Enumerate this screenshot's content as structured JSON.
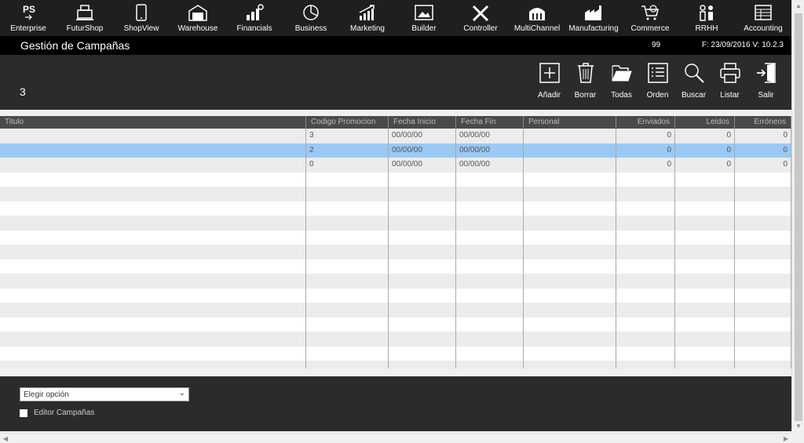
{
  "nav": [
    {
      "label": "Enterprise",
      "icon": "ps-enterprise-icon"
    },
    {
      "label": "FuturShop",
      "icon": "cash-register-icon"
    },
    {
      "label": "ShopView",
      "icon": "tablet-icon"
    },
    {
      "label": "Warehouse",
      "icon": "warehouse-icon"
    },
    {
      "label": "Financials",
      "icon": "bar-chart-icon"
    },
    {
      "label": "Business",
      "icon": "pie-chart-icon"
    },
    {
      "label": "Marketing",
      "icon": "growth-chart-icon"
    },
    {
      "label": "Builder",
      "icon": "image-frame-icon"
    },
    {
      "label": "Controller",
      "icon": "tools-icon"
    },
    {
      "label": "MultiChannel",
      "icon": "building-icon"
    },
    {
      "label": "Manufacturing",
      "icon": "factory-icon"
    },
    {
      "label": "Commerce",
      "icon": "cart-icon"
    },
    {
      "label": "RRHH",
      "icon": "people-icon"
    },
    {
      "label": "Accounting",
      "icon": "ledger-icon"
    }
  ],
  "enterprise_logo": "PS",
  "title": "Gestión de Campañas",
  "title_number": "99",
  "version": "F: 23/09/2016 V: 10.2.3",
  "record_count": "3",
  "tools": [
    {
      "label": "Añadir",
      "icon": "add-icon"
    },
    {
      "label": "Borrar",
      "icon": "trash-icon"
    },
    {
      "label": "Todas",
      "icon": "folder-open-icon"
    },
    {
      "label": "Orden",
      "icon": "list-icon"
    },
    {
      "label": "Buscar",
      "icon": "search-icon"
    },
    {
      "label": "Listar",
      "icon": "printer-icon"
    },
    {
      "label": "Salir",
      "icon": "exit-icon"
    }
  ],
  "grid": {
    "columns": [
      "Titulo",
      "Codigo Promocion",
      "Fecha Inicio",
      "Fecha Fin",
      "Personal",
      "Enviados",
      "Leidos",
      "Erróneos"
    ],
    "rows": [
      [
        "",
        "3",
        "00/00/00",
        "00/00/00",
        "",
        "0",
        "0",
        "0"
      ],
      [
        "",
        "2",
        "00/00/00",
        "00/00/00",
        "",
        "0",
        "0",
        "0"
      ],
      [
        "",
        "0",
        "00/00/00",
        "00/00/00",
        "",
        "0",
        "0",
        "0"
      ]
    ],
    "selected_row": 1
  },
  "select": {
    "value": "Elegir opción"
  },
  "checkbox": {
    "label": "Editor Campañas"
  },
  "colors": {
    "topnav": "#1f1f1f",
    "panel": "#2b2b2b",
    "selected": "#99c9f5"
  }
}
